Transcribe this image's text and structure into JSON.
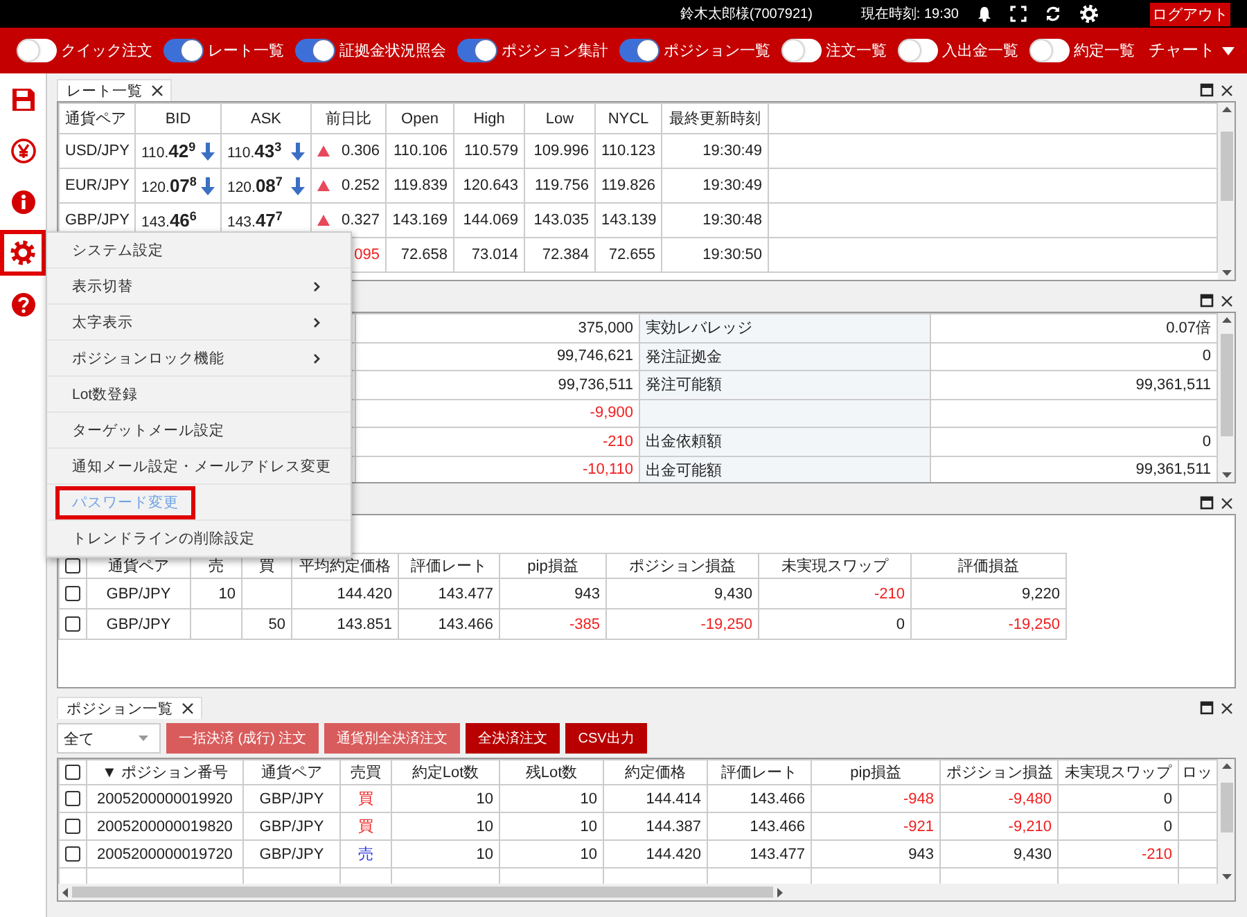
{
  "header": {
    "user": "鈴木太郎様(7007921)",
    "clock": "現在時刻: 19:30",
    "logout": "ログアウト"
  },
  "nav": {
    "toggles": [
      {
        "label": "クイック注文",
        "on": false
      },
      {
        "label": "レート一覧",
        "on": true
      },
      {
        "label": "証拠金状況照会",
        "on": true
      },
      {
        "label": "ポジション集計",
        "on": true
      },
      {
        "label": "ポジション一覧",
        "on": true
      },
      {
        "label": "注文一覧",
        "on": false
      },
      {
        "label": "入出金一覧",
        "on": false
      },
      {
        "label": "約定一覧",
        "on": false
      }
    ],
    "chart_menu": "チャート"
  },
  "sidebar": {
    "items": [
      {
        "kind": "save",
        "selected": false
      },
      {
        "kind": "yen",
        "selected": false
      },
      {
        "kind": "info",
        "selected": false
      },
      {
        "kind": "settings",
        "selected": true
      },
      {
        "kind": "help",
        "selected": false
      }
    ]
  },
  "settings_menu": {
    "items": [
      {
        "label": "システム設定",
        "submenu": false,
        "selected": false
      },
      {
        "label": "表示切替",
        "submenu": true,
        "selected": false
      },
      {
        "label": "太字表示",
        "submenu": true,
        "selected": false
      },
      {
        "label": "ポジションロック機能",
        "submenu": true,
        "selected": false
      },
      {
        "label": "Lot数登録",
        "submenu": false,
        "selected": false
      },
      {
        "label": "ターゲットメール設定",
        "submenu": false,
        "selected": false
      },
      {
        "label": "通知メール設定・メールアドレス変更",
        "submenu": false,
        "selected": false
      },
      {
        "label": "パスワード変更",
        "submenu": false,
        "selected": true
      },
      {
        "label": "トレンドラインの削除設定",
        "submenu": false,
        "selected": false
      }
    ]
  },
  "rate_panel": {
    "tab": "レート一覧",
    "columns": [
      "通貨ペア",
      "BID",
      "ASK",
      "前日比",
      "Open",
      "High",
      "Low",
      "NYCL",
      "最終更新時刻"
    ],
    "rows": [
      {
        "pair": "USD/JPY",
        "bid": "110.**42**$^{9}$",
        "bid_down": true,
        "ask": "110.**43**$^{3}$",
        "ask_down": true,
        "change": "0.306",
        "change_up": true,
        "change_negative": false,
        "open": "110.106",
        "high": "110.579",
        "low": "109.996",
        "nycl": "110.123",
        "updated": "19:30:49"
      },
      {
        "pair": "EUR/JPY",
        "bid": "120.**07**$^{8}$",
        "bid_down": true,
        "ask": "120.**08**$^{7}$",
        "ask_down": true,
        "change": "0.252",
        "change_up": true,
        "change_negative": false,
        "open": "119.839",
        "high": "120.643",
        "low": "119.756",
        "nycl": "119.826",
        "updated": "19:30:49"
      },
      {
        "pair": "GBP/JPY",
        "bid": "143.**46**$^{6}$",
        "bid_down": false,
        "ask": "143.**47**$^{7}$",
        "ask_down": false,
        "change": "0.327",
        "change_up": true,
        "change_negative": false,
        "open": "143.169",
        "high": "144.069",
        "low": "143.035",
        "nycl": "143.139",
        "updated": "19:30:48"
      },
      {
        "change": "095",
        "change_negative": true,
        "open": "72.658",
        "high": "73.014",
        "low": "72.384",
        "nycl": "72.655",
        "updated": "19:30:50"
      }
    ]
  },
  "account_panel": {
    "rows": [
      {
        "column_2": "375,000",
        "label": "実効レバレッジ",
        "value": "0.07倍"
      },
      {
        "column_2": "99,746,621",
        "label": "発注証拠金",
        "value": "0"
      },
      {
        "column_2": "99,736,511",
        "label": "発注可能額",
        "value": "99,361,511"
      },
      {
        "column_2": {
          "text": "-9,900",
          "negative": true
        }
      },
      {
        "column_2": {
          "text": "-210",
          "negative": true
        },
        "label": "出金依頼額",
        "value": "0"
      },
      {
        "column_2": {
          "text": "-10,110",
          "negative": true
        },
        "label": "出金可能額",
        "value": "99,361,511"
      }
    ]
  },
  "summary_panel": {
    "all_checked": false,
    "columns": [
      "通貨ペア",
      "売",
      "買",
      "平均約定価格",
      "評価レート",
      "pip損益",
      "ポジション損益",
      "未実現スワップ",
      "評価損益"
    ],
    "rows": [
      {
        "checked": false,
        "pair": "GBP/JPY",
        "sell": "10",
        "avg_price": "144.420",
        "rate": "143.477",
        "pip": "943",
        "pl": "9,430",
        "swap": {
          "text": "-210",
          "negative": true
        },
        "eval": "9,220"
      },
      {
        "checked": false,
        "pair": "GBP/JPY",
        "buy": "50",
        "avg_price": "143.851",
        "rate": "143.466",
        "pip": {
          "text": "-385",
          "negative": true
        },
        "pl": {
          "text": "-19,250",
          "negative": true
        },
        "swap": "0",
        "eval": {
          "text": "-19,250",
          "negative": true
        }
      }
    ]
  },
  "positions_panel": {
    "tab": "ポジション一覧",
    "filter": "全て",
    "buttons": [
      {
        "label": "一括決済 (成行) 注文",
        "disabled": true
      },
      {
        "label": "通貨別全決済注文",
        "disabled": true
      },
      {
        "label": "全決済注文",
        "disabled": false
      },
      {
        "label": "CSV出力",
        "disabled": false
      }
    ],
    "all_checked": false,
    "columns": [
      "▼ ポジション番号",
      "通貨ペア",
      "売買",
      "約定Lot数",
      "残Lot数",
      "約定価格",
      "評価レート",
      "pip損益",
      "ポジション損益",
      "未実現スワップ",
      "ロッ"
    ],
    "rows": [
      {
        "checked": false,
        "cells": [
          "2005200000019920",
          "GBP/JPY",
          {
            "text": "買",
            "kind": "buy"
          },
          "10",
          "10",
          "144.414",
          "143.466",
          {
            "text": "-948",
            "negative": true
          },
          {
            "text": "-9,480",
            "negative": true
          },
          "0"
        ]
      },
      {
        "checked": false,
        "cells": [
          "2005200000019820",
          "GBP/JPY",
          {
            "text": "買",
            "kind": "buy"
          },
          "10",
          "10",
          "144.387",
          "143.466",
          {
            "text": "-921",
            "negative": true
          },
          {
            "text": "-9,210",
            "negative": true
          },
          "0"
        ]
      },
      {
        "checked": false,
        "cells": [
          "2005200000019720",
          "GBP/JPY",
          {
            "text": "売",
            "kind": "sell"
          },
          "10",
          "10",
          "144.420",
          "143.477",
          "943",
          "9,430",
          {
            "text": "-210",
            "negative": true
          }
        ]
      }
    ]
  }
}
